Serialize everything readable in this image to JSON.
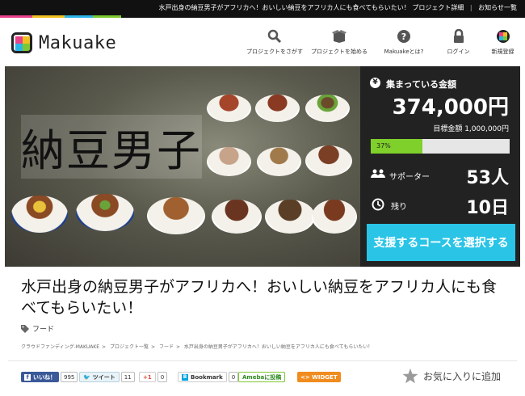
{
  "topbar": {
    "ticker": "水戸出身の納豆男子がアフリカへ！おいしい納豆をアフリカ人にも食べてもらいたい！ プロジェクト詳細",
    "separator": "|",
    "news_link": "お知らせ一覧",
    "rainbow_colors": [
      "#e8428c",
      "#f0c020",
      "#2ab5e8",
      "#7dc832"
    ]
  },
  "header": {
    "logo_text": "Makuake",
    "nav": [
      {
        "label": "プロジェクトをさがす",
        "icon": "search-icon"
      },
      {
        "label": "プロジェクトを始める",
        "icon": "box-icon"
      },
      {
        "label": "Makuakeとは?",
        "icon": "question-icon"
      },
      {
        "label": "ログイン",
        "icon": "lock-icon"
      },
      {
        "label": "新規登録",
        "icon": "makuake-mark-icon"
      }
    ]
  },
  "hero": {
    "title": "納豆男子"
  },
  "panel": {
    "raised_label": "集まっている金額",
    "raised_amount": "374,000円",
    "goal_label": "目標金額 1,000,000円",
    "progress_text": "37%",
    "progress": 0.37,
    "supporters_label": "サポーター",
    "supporters_value": "53人",
    "remaining_label": "残り",
    "remaining_value": "10日",
    "cta_label": "支援するコースを選択する",
    "accent": "#29c4e6",
    "progress_color": "#7fd02b"
  },
  "project": {
    "title": "水戸出身の納豆男子がアフリカへ！おいしい納豆をアフリカ人にも食べてもらいたい！",
    "category": "フード",
    "breadcrumb": [
      "クラウドファンディング-MAKUAKE",
      "プロジェクト一覧",
      "フード",
      "水戸出身の納豆男子がアフリカへ！おいしい納豆をアフリカ人にも食べてもらいたい！"
    ],
    "breadcrumb_sep": ">"
  },
  "social": {
    "like_label": "いいね！",
    "like_count": "995",
    "tweet_label": "ツイート",
    "tweet_count": "11",
    "gplus_label": "+1",
    "gplus_count": "0",
    "bookmark_label": "Bookmark",
    "bookmark_count": "0",
    "ameba_label": "Amebaに投稿",
    "widget_label": "<> WIDGET",
    "favorite_label": "お気に入りに追加"
  }
}
